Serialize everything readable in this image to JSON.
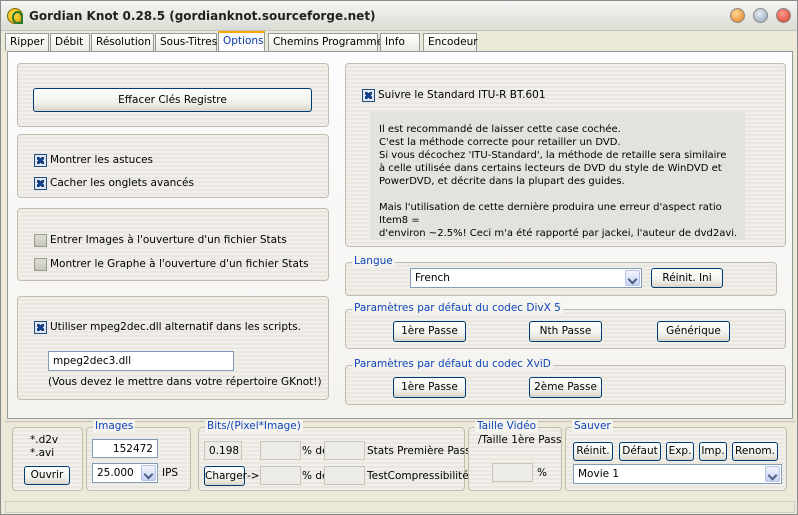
{
  "window": {
    "title": "Gordian Knot 0.28.5 (gordianknot.sourceforge.net)",
    "icon": "gordian-knot-app-icon",
    "controls": [
      "minimize-icon",
      "maximize-icon",
      "close-icon"
    ]
  },
  "tabs": [
    "Ripper",
    "Débit",
    "Résolution",
    "Sous-Titres",
    "Options",
    "Chemins Programmes",
    "Info",
    "Encodeur"
  ],
  "active_tab": "Options",
  "options": {
    "clear_keys_button": "Effacer Clés Registre",
    "show_tips": {
      "label": "Montrer les astuces",
      "checked": true
    },
    "hide_advanced_tabs": {
      "label": "Cacher les onglets avancés",
      "checked": true
    },
    "enter_images_stats": {
      "label": "Entrer Images à l'ouverture d'un fichier Stats",
      "checked": false
    },
    "show_graph_stats": {
      "label": "Montrer le Graphe à l'ouverture d'un fichier Stats",
      "checked": false
    },
    "use_mpeg2dec": {
      "label": "Utiliser mpeg2dec.dll alternatif dans les scripts.",
      "checked": true
    },
    "mpeg2dec_value": "mpeg2dec3.dll",
    "mpeg2dec_note": "(Vous devez le mettre dans votre répertoire GKnot!)",
    "itu_standard": {
      "label": "Suivre le Standard ITU-R BT.601",
      "checked": true
    },
    "info_text": "Il est recommandé de laisser cette case cochée.\nC'est la méthode correcte pour retailler un DVD.\nSi vous décochez 'ITU-Standard', la méthode de retaille sera similaire\nà celle utilisée dans certains lecteurs de DVD du style de WinDVD et\nPowerDVD, et décrite dans la plupart des guides.\n\nMais l'utilisation de cette dernière produira une erreur d'aspect ratio Item8 =\nd'environ ~2.5%! Ceci m'a été rapporté par jackei, l'auteur de dvd2avi.",
    "langue": {
      "title": "Langue",
      "value": "French",
      "reset_button": "Réinit. Ini"
    },
    "divx5": {
      "title": "Paramètres par défaut du codec DivX 5",
      "buttons": [
        "1ère Passe",
        "Nth Passe",
        "Générique"
      ]
    },
    "xvid": {
      "title": "Paramètres par défaut du codec XviD",
      "buttons": [
        "1ère Passe",
        "2ème Passe"
      ]
    }
  },
  "bottom": {
    "d2v": "*.d2v",
    "avi": "*.avi",
    "open_button": "Ouvrir",
    "images": {
      "title": "Images",
      "value": "152472",
      "fps": "25.000",
      "fps_unit": "IPS"
    },
    "bits": {
      "title": "Bits/(Pixel*Image)",
      "value": "0.198",
      "pct_de_1": "% de",
      "stats_label": "Stats Première Pass",
      "charger_button": "Charger",
      "arrow": "->",
      "pct_de_2": "% de",
      "test_label": "TestCompressibilité"
    },
    "taille": {
      "title": "Taille Vidéo",
      "subtitle": "/Taille 1ère Pass",
      "pct": "%"
    },
    "sauver": {
      "title": "Sauver",
      "buttons": [
        "Réinit.",
        "Défaut",
        "Exp.",
        "Imp.",
        "Renom."
      ],
      "preset": "Movie 1"
    }
  },
  "colors": {
    "accent": "#1046b8",
    "tab_active_top": "#f8a800",
    "window_bg": "#ece9d8"
  }
}
